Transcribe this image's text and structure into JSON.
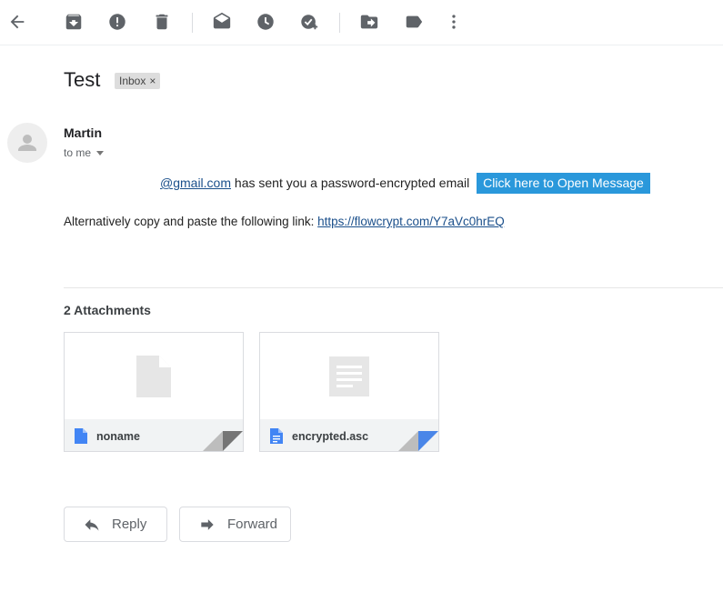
{
  "toolbar": {
    "icons": [
      "back-arrow-icon",
      "archive-icon",
      "report-spam-icon",
      "delete-icon",
      "mark-unread-icon",
      "snooze-icon",
      "add-task-icon",
      "move-to-icon",
      "label-icon",
      "more-vert-icon"
    ]
  },
  "message": {
    "subject": "Test",
    "label_chip": "Inbox",
    "label_remove": "×",
    "sender_name": "Martin",
    "recipient": "to me",
    "sender_email_link": "@gmail.com",
    "notice_text": " has sent you a password-encrypted email ",
    "open_button": "Click here to Open Message",
    "alt_text": "Alternatively copy and paste the following link: ",
    "alt_link": "https://flowcrypt.com/Y7aVc0hrEQ"
  },
  "attachments": {
    "header": "2 Attachments",
    "items": [
      {
        "name": "noname",
        "file_icon": "generic-file-icon",
        "fold_color": "#757575"
      },
      {
        "name": "encrypted.asc",
        "file_icon": "text-document-icon",
        "fold_color": "#4a86e8"
      }
    ]
  },
  "actions": {
    "reply_label": "Reply",
    "forward_label": "Forward"
  },
  "colors": {
    "open_button_bg": "#2a98db",
    "link": "#1a4f8b",
    "doc_blue": "#4285f4"
  }
}
